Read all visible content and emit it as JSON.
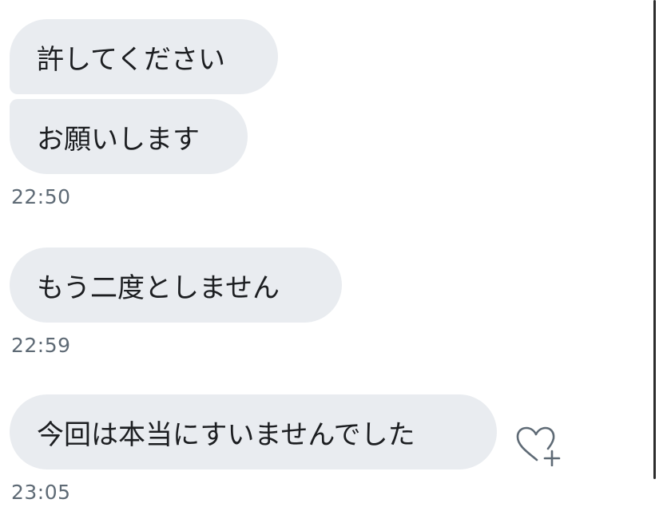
{
  "messages": [
    {
      "text": "許してください"
    },
    {
      "text": "お願いします"
    },
    {
      "text": "もう二度としません"
    },
    {
      "text": "今回は本当にすいませんでした"
    }
  ],
  "timestamps": [
    "22:50",
    "22:59",
    "23:05"
  ],
  "icons": {
    "reaction": "heart-plus-icon"
  },
  "colors": {
    "bubble": "#e9ecf0",
    "text": "#1c1e21",
    "timestamp": "#5e6a75"
  }
}
